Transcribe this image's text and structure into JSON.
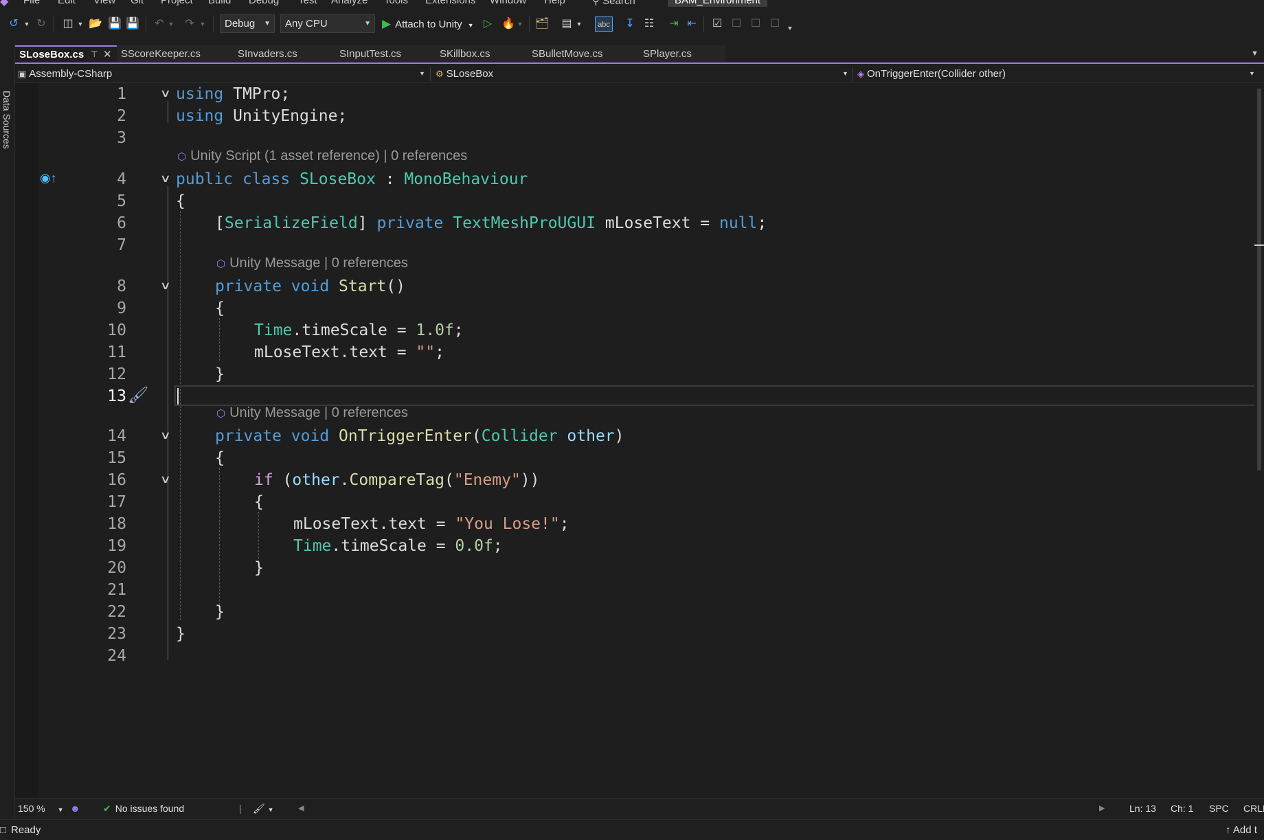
{
  "menu": {
    "items": [
      "File",
      "Edit",
      "View",
      "Git",
      "Project",
      "Build",
      "Debug",
      "Test",
      "Analyze",
      "Tools",
      "Extensions",
      "Window",
      "Help"
    ],
    "search": "Search",
    "project_name": "BAM_Environment"
  },
  "toolbar": {
    "configuration": "Debug",
    "platform": "Any CPU",
    "attach_label": "Attach to Unity"
  },
  "left_strip": {
    "label": "Data Sources"
  },
  "tabs": [
    {
      "label": "SLoseBox.cs",
      "active": true
    },
    {
      "label": "SScoreKeeper.cs"
    },
    {
      "label": "SInvaders.cs"
    },
    {
      "label": "SInputTest.cs"
    },
    {
      "label": "SKillbox.cs"
    },
    {
      "label": "SBulletMove.cs"
    },
    {
      "label": "SPlayer.cs"
    }
  ],
  "navbar": {
    "project": "Assembly-CSharp",
    "type": "SLoseBox",
    "member": "OnTriggerEnter(Collider other)"
  },
  "codelens": {
    "class_lens": "Unity Script (1 asset reference) | 0 references",
    "start_lens": "Unity Message | 0 references",
    "trigger_lens": "Unity Message | 0 references"
  },
  "line_numbers": [
    "1",
    "2",
    "3",
    "4",
    "5",
    "6",
    "7",
    "8",
    "9",
    "10",
    "11",
    "12",
    "13",
    "14",
    "15",
    "16",
    "17",
    "18",
    "19",
    "20",
    "21",
    "22",
    "23",
    "24"
  ],
  "code": {
    "l1_kw": "using",
    "l1_rest": " TMPro;",
    "l2_kw": "using",
    "l2_rest": " UnityEngine;",
    "l4_kw1": "public",
    "l4_kw2": "class",
    "l4_name": "SLoseBox",
    "l4_colon": " : ",
    "l4_base": "MonoBehaviour",
    "l5": "{",
    "l6_open": "[",
    "l6_attr": "SerializeField",
    "l6_close": "] ",
    "l6_kw": "private",
    "l6_type": "TextMeshProUGUI",
    "l6_var": " mLoseText = ",
    "l6_null": "null",
    "l6_end": ";",
    "l8_kw1": "private",
    "l8_kw2": "void",
    "l8_fn": "Start",
    "l8_rest": "()",
    "l9": "{",
    "l10_type": "Time",
    "l10_rest": ".timeScale = ",
    "l10_num": "1.0f",
    "l10_end": ";",
    "l11_rest": "mLoseText.text = ",
    "l11_str": "\"\"",
    "l11_end": ";",
    "l12": "}",
    "l14_kw1": "private",
    "l14_kw2": "void",
    "l14_fn": "OnTriggerEnter",
    "l14_p1": "(",
    "l14_type": "Collider",
    "l14_param": "other",
    "l14_p2": ")",
    "l15": "{",
    "l16_kw": "if",
    "l16_p": " (",
    "l16_param": "other",
    "l16_dot": ".",
    "l16_fn": "CompareTag",
    "l16_p2": "(",
    "l16_str": "\"Enemy\"",
    "l16_end": "))",
    "l17": "{",
    "l18_rest": "mLoseText.text = ",
    "l18_str": "\"You Lose!\"",
    "l18_end": ";",
    "l19_type": "Time",
    "l19_rest": ".timeScale = ",
    "l19_num": "0.0f",
    "l19_end": ";",
    "l20": "}",
    "l22": "}",
    "l23": "}"
  },
  "editor_status": {
    "zoom": "150 %",
    "issues": "No issues found",
    "ln": "Ln: 13",
    "ch": "Ch: 1",
    "spc": "SPC",
    "crlf": "CRLF"
  },
  "statusbar": {
    "ready": "Ready",
    "add": "Add t"
  },
  "colors": {
    "accent": "#9b7ce8",
    "keyword": "#569cd6",
    "type": "#4ec9b0",
    "function": "#dcdcaa",
    "string": "#d69d85",
    "number": "#b5cea8",
    "control": "#d8a0df",
    "success": "#3fb950"
  }
}
